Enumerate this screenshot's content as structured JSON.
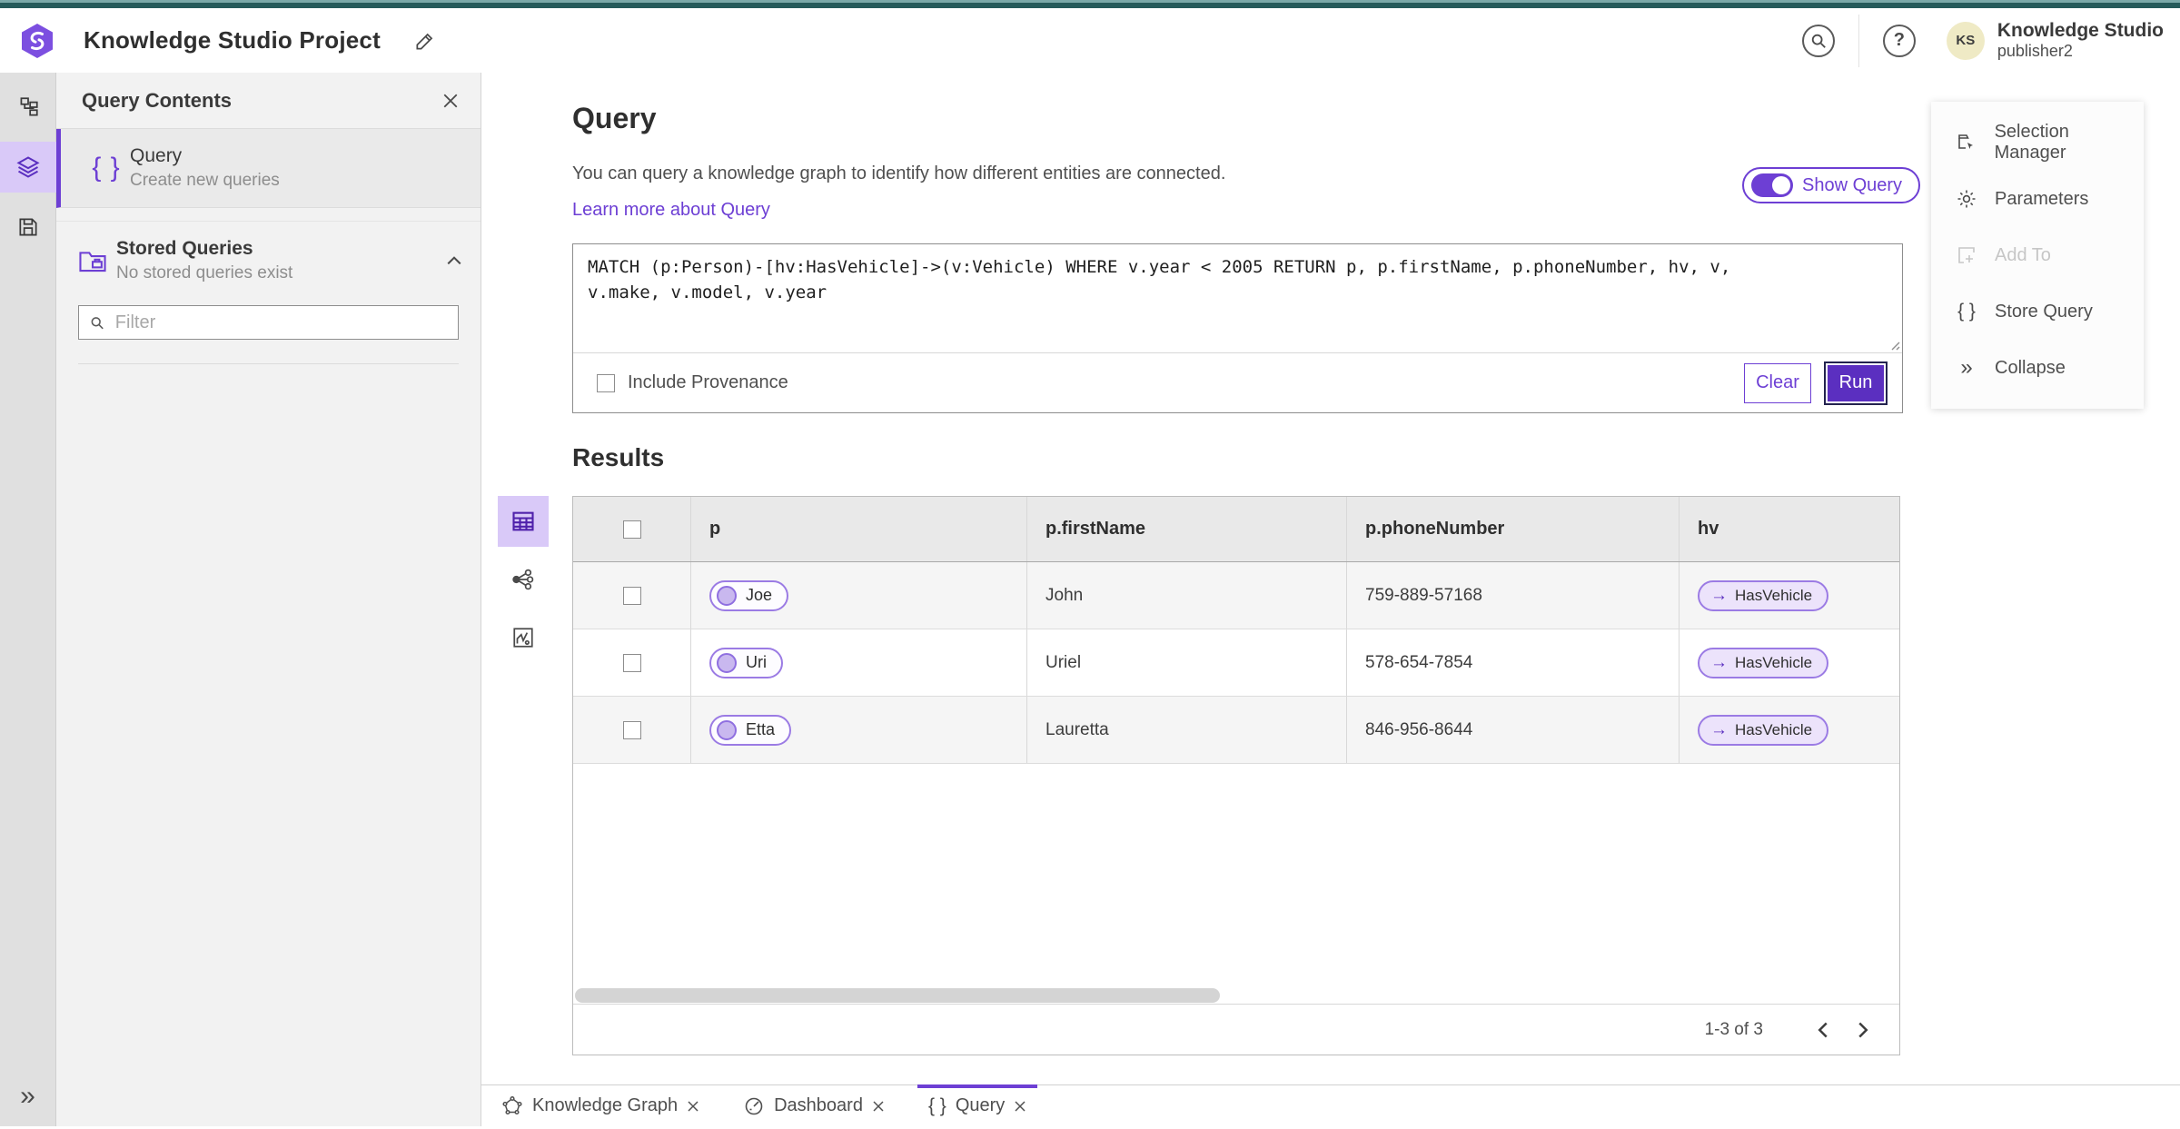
{
  "colors": {
    "accent": "#6d3fd4",
    "accent_dark": "#5b2fc0",
    "accent_light_bg": "#d9c9f8",
    "pill_fill": "#ece3fb",
    "pill_border": "#9b7be4",
    "teal_bar": "#255a5a",
    "avatar_bg": "#efeac5",
    "rail_bg": "#e0e0e0",
    "panel_bg": "#f2f2f2",
    "table_header_bg": "#e9e9e9",
    "row_alt_bg": "#f5f5f5"
  },
  "topbar": {
    "app_title": "Knowledge Studio Project",
    "user_name": "Knowledge Studio",
    "user_role": "publisher2",
    "avatar_initials": "KS"
  },
  "left_panel": {
    "title": "Query Contents",
    "query_item": {
      "label": "Query",
      "sublabel": "Create new queries"
    },
    "stored_item": {
      "label": "Stored Queries",
      "sublabel": "No stored queries exist"
    },
    "filter_placeholder": "Filter"
  },
  "query_section": {
    "title": "Query",
    "description": "You can query a knowledge graph to identify how different entities are connected.",
    "learn_more": "Learn more about Query",
    "show_query": "Show Query",
    "query_text": "MATCH (p:Person)-[hv:HasVehicle]->(v:Vehicle) WHERE v.year < 2005 RETURN p, p.firstName, p.phoneNumber, hv, v, v.make, v.model, v.year",
    "include_provenance": "Include Provenance",
    "clear": "Clear",
    "run": "Run"
  },
  "results": {
    "title": "Results",
    "columns": [
      "p",
      "p.firstName",
      "p.phoneNumber",
      "hv"
    ],
    "rows": [
      {
        "p": "Joe",
        "firstName": "John",
        "phone": "759-889-57168",
        "hv": "HasVehicle"
      },
      {
        "p": "Uri",
        "firstName": "Uriel",
        "phone": "578-654-7854",
        "hv": "HasVehicle"
      },
      {
        "p": "Etta",
        "firstName": "Lauretta",
        "phone": "846-956-8644",
        "hv": "HasVehicle"
      }
    ],
    "pagination": "1-3 of 3"
  },
  "right_menu": {
    "items": [
      {
        "label": "Selection Manager"
      },
      {
        "label": "Parameters"
      },
      {
        "label": "Add To"
      },
      {
        "label": "Store Query"
      },
      {
        "label": "Collapse"
      }
    ]
  },
  "tabs": [
    {
      "label": "Knowledge Graph"
    },
    {
      "label": "Dashboard"
    },
    {
      "label": "Query"
    }
  ],
  "glyphs": {
    "braces": "{ }",
    "double_chevron": "»",
    "edge_arrow": "→"
  }
}
